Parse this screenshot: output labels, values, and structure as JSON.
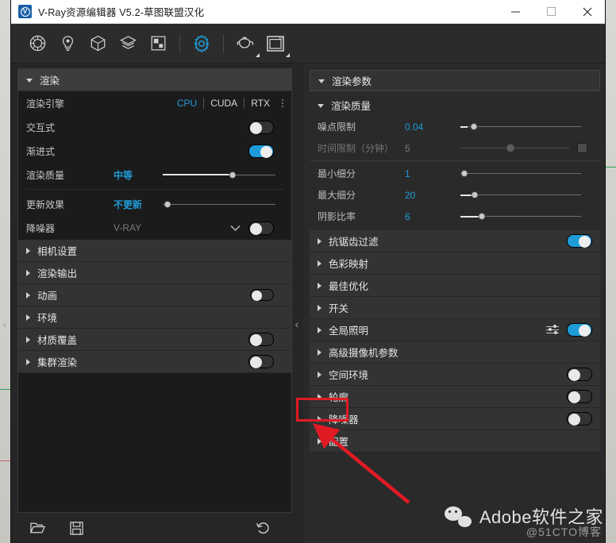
{
  "window": {
    "title": "V-Ray资源编辑器 V5.2-草图联盟汉化",
    "logo_glyph": "V",
    "minimize_label": "—",
    "maximize_label": "□",
    "close_label": "✕"
  },
  "toolbar": {
    "items": [
      {
        "name": "material-sphere-icon",
        "tooltip": "材质"
      },
      {
        "name": "light-bulb-icon",
        "tooltip": "灯光"
      },
      {
        "name": "geometry-cube-icon",
        "tooltip": "几何体"
      },
      {
        "name": "layers-icon",
        "tooltip": "渲染元素"
      },
      {
        "name": "texture-icon",
        "tooltip": "纹理"
      },
      {
        "name": "gear-icon",
        "tooltip": "设置",
        "active": true
      },
      {
        "name": "teapot-render-icon",
        "tooltip": "渲染"
      },
      {
        "name": "frame-buffer-icon",
        "tooltip": "帧缓存"
      }
    ]
  },
  "left_panel": {
    "header": {
      "label": "渲染",
      "expanded": true
    },
    "render_engine": {
      "label": "渲染引擎",
      "options": [
        "CPU",
        "CUDA",
        "RTX"
      ],
      "selected": "CPU"
    },
    "interactive": {
      "label": "交互式",
      "toggle": false
    },
    "progressive": {
      "label": "渐进式",
      "toggle": true
    },
    "quality": {
      "label": "渲染质量",
      "value": "中等",
      "slider_pct": 62
    },
    "update_effect": {
      "label": "更新效果",
      "value": "不更新",
      "slider_pct": 4
    },
    "denoiser": {
      "label": "降噪器",
      "value": "V-RAY",
      "toggle": false
    },
    "sections": [
      {
        "label": "相机设置",
        "toggle": null
      },
      {
        "label": "渲染输出",
        "toggle": null
      },
      {
        "label": "动画",
        "toggle": false,
        "small": true
      },
      {
        "label": "环境",
        "toggle": null
      },
      {
        "label": "材质覆盖",
        "toggle": false
      },
      {
        "label": "集群渲染",
        "toggle": false
      }
    ],
    "bottom_bar": {
      "open_label": "打开",
      "save_label": "保存",
      "reset_label": "重置"
    }
  },
  "right_panel": {
    "header": {
      "label": "渲染参数",
      "expanded": true
    },
    "quality_group": {
      "label": "渲染质量",
      "expanded": true
    },
    "properties": [
      {
        "label": "噪点限制",
        "value": "0.04",
        "slider_pct": 11,
        "fill_pct": 6,
        "disabled": false,
        "checkbox": false
      },
      {
        "label": "时间限制（分钟）",
        "value": "5",
        "slider_pct": 46,
        "fill_pct": 0,
        "disabled": true,
        "checkbox": true
      },
      {
        "label": "最小细分",
        "value": "1",
        "slider_pct": 3,
        "fill_pct": 0,
        "disabled": false,
        "checkbox": false
      },
      {
        "label": "最大细分",
        "value": "20",
        "slider_pct": 12,
        "fill_pct": 12,
        "disabled": false,
        "checkbox": false
      },
      {
        "label": "阴影比率",
        "value": "6",
        "slider_pct": 18,
        "fill_pct": 18,
        "disabled": false,
        "checkbox": false
      }
    ],
    "sections": [
      {
        "label": "抗锯齿过滤",
        "toggle": true,
        "gear": false
      },
      {
        "label": "色彩映射",
        "toggle": null,
        "gear": false
      },
      {
        "label": "最佳优化",
        "toggle": null,
        "gear": false
      },
      {
        "label": "开关",
        "toggle": null,
        "gear": false
      },
      {
        "label": "全局照明",
        "toggle": true,
        "gear": true
      },
      {
        "label": "高级摄像机参数",
        "toggle": null,
        "gear": false
      },
      {
        "label": "空间环境",
        "toggle": false,
        "gear": false
      },
      {
        "label": "轮廓",
        "toggle": false,
        "gear": false
      },
      {
        "label": "降噪器",
        "toggle": false,
        "gear": false
      },
      {
        "label": "配置",
        "toggle": null,
        "gear": false,
        "highlighted": true
      }
    ]
  },
  "annotation": {
    "highlight_color": "#e01b24",
    "target_label": "配置"
  },
  "watermark": {
    "brand": "Adobe软件之家",
    "source": "@51CTO博客"
  }
}
